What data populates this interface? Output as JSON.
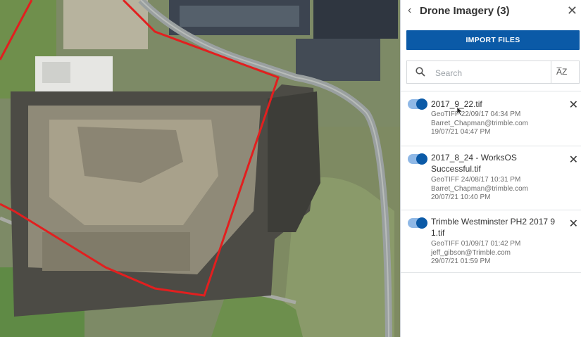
{
  "panel": {
    "title": "Drone Imagery (3)",
    "back_icon": "chevron-left-icon",
    "close_icon": "close-icon",
    "import_label": "IMPORT FILES",
    "search_placeholder": "Search",
    "sort_label": "A̅Z",
    "accent_color": "#0b5aa7"
  },
  "files": [
    {
      "name": "2017_9_22.tif",
      "line1": "GeoTIFF 22/09/17 04:34 PM",
      "line2": "Barret_Chapman@trimble.com",
      "line3": "19/07/21 04:47 PM",
      "enabled": true
    },
    {
      "name": "2017_8_24 - WorksOS Successful.tif",
      "line1": "GeoTIFF 24/08/17 10:31 PM",
      "line2": "Barret_Chapman@trimble.com",
      "line3": "20/07/21 10:40 PM",
      "enabled": true
    },
    {
      "name": "Trimble Westminster PH2 2017 9 1.tif",
      "line1": "GeoTIFF 01/09/17 01:42 PM",
      "line2": "jeff_gibson@Trimble.com",
      "line3": "29/07/21 01:59 PM",
      "enabled": true
    }
  ]
}
